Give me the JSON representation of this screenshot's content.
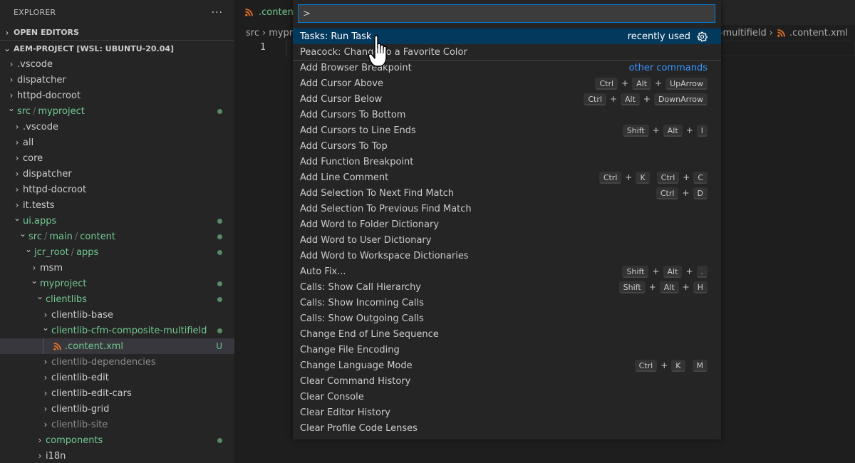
{
  "sidebar": {
    "title": "EXPLORER",
    "more_label": "···",
    "open_editors_label": "OPEN EDITORS",
    "root_label": "AEM-PROJECT [WSL: UBUNTU-20.04]",
    "tree": [
      {
        "label": ".vscode",
        "depth": 0,
        "expanded": false,
        "style": "normal"
      },
      {
        "label": "dispatcher",
        "depth": 0,
        "expanded": false,
        "style": "normal"
      },
      {
        "label": "httpd-docroot",
        "depth": 0,
        "expanded": false,
        "style": "normal"
      },
      {
        "label": "src / myproject",
        "parts": [
          "src",
          "myproject"
        ],
        "depth": 0,
        "expanded": true,
        "style": "green",
        "dot": true
      },
      {
        "label": ".vscode",
        "depth": 1,
        "expanded": false,
        "style": "normal"
      },
      {
        "label": "all",
        "depth": 1,
        "expanded": false,
        "style": "normal"
      },
      {
        "label": "core",
        "depth": 1,
        "expanded": false,
        "style": "normal"
      },
      {
        "label": "dispatcher",
        "depth": 1,
        "expanded": false,
        "style": "normal"
      },
      {
        "label": "httpd-docroot",
        "depth": 1,
        "expanded": false,
        "style": "normal"
      },
      {
        "label": "it.tests",
        "depth": 1,
        "expanded": false,
        "style": "normal"
      },
      {
        "label": "ui.apps",
        "depth": 1,
        "expanded": true,
        "style": "green",
        "dot": true
      },
      {
        "label": "src / main / content",
        "parts": [
          "src",
          "main",
          "content"
        ],
        "depth": 2,
        "expanded": true,
        "style": "green",
        "dot": true
      },
      {
        "label": "jcr_root / apps",
        "parts": [
          "jcr_root",
          "apps"
        ],
        "depth": 3,
        "expanded": true,
        "style": "green",
        "dot": true
      },
      {
        "label": "msm",
        "depth": 4,
        "expanded": false,
        "style": "normal"
      },
      {
        "label": "myproject",
        "depth": 4,
        "expanded": true,
        "style": "green",
        "dot": true
      },
      {
        "label": "clientlibs",
        "depth": 5,
        "expanded": true,
        "style": "green",
        "dot": true
      },
      {
        "label": "clientlib-base",
        "depth": 6,
        "expanded": false,
        "style": "normal"
      },
      {
        "label": "clientlib-cfm-composite-multifield",
        "depth": 6,
        "expanded": true,
        "style": "green",
        "dot": true
      },
      {
        "label": ".content.xml",
        "depth": 7,
        "file": true,
        "icon": "rss-icon",
        "style": "green",
        "badge": "U",
        "selected": true
      },
      {
        "label": "clientlib-dependencies",
        "depth": 6,
        "expanded": false,
        "style": "dim"
      },
      {
        "label": "clientlib-edit",
        "depth": 6,
        "expanded": false,
        "style": "normal"
      },
      {
        "label": "clientlib-edit-cars",
        "depth": 6,
        "expanded": false,
        "style": "normal"
      },
      {
        "label": "clientlib-grid",
        "depth": 6,
        "expanded": false,
        "style": "normal"
      },
      {
        "label": "clientlib-site",
        "depth": 6,
        "expanded": false,
        "style": "dim"
      },
      {
        "label": "components",
        "depth": 5,
        "expanded": false,
        "style": "green",
        "dot": true
      },
      {
        "label": "i18n",
        "depth": 5,
        "expanded": false,
        "style": "normal"
      }
    ]
  },
  "editor": {
    "tab_label": ".content.",
    "breadcrumb_left": [
      "src",
      "mypro"
    ],
    "breadcrumb_right": [
      "te-multifield",
      ".content.xml"
    ],
    "line_number": "1"
  },
  "palette": {
    "input_value": ">",
    "items": [
      {
        "label": "Tasks: Run Task",
        "active": true,
        "meta": "recently used",
        "gear": true
      },
      {
        "label": "Peacock: Change to a Favorite Color"
      },
      {
        "label": "Add Browser Breakpoint",
        "other": "other commands",
        "sep_top": true
      },
      {
        "label": "Add Cursor Above",
        "keys": [
          [
            "Ctrl",
            "Alt",
            "UpArrow"
          ]
        ]
      },
      {
        "label": "Add Cursor Below",
        "keys": [
          [
            "Ctrl",
            "Alt",
            "DownArrow"
          ]
        ]
      },
      {
        "label": "Add Cursors To Bottom"
      },
      {
        "label": "Add Cursors to Line Ends",
        "keys": [
          [
            "Shift",
            "Alt",
            "I"
          ]
        ]
      },
      {
        "label": "Add Cursors To Top"
      },
      {
        "label": "Add Function Breakpoint"
      },
      {
        "label": "Add Line Comment",
        "keys": [
          [
            "Ctrl",
            "K"
          ],
          [
            "Ctrl",
            "C"
          ]
        ]
      },
      {
        "label": "Add Selection To Next Find Match",
        "keys": [
          [
            "Ctrl",
            "D"
          ]
        ]
      },
      {
        "label": "Add Selection To Previous Find Match"
      },
      {
        "label": "Add Word to Folder Dictionary"
      },
      {
        "label": "Add Word to User Dictionary"
      },
      {
        "label": "Add Word to Workspace Dictionaries"
      },
      {
        "label": "Auto Fix...",
        "keys": [
          [
            "Shift",
            "Alt",
            "."
          ]
        ]
      },
      {
        "label": "Calls: Show Call Hierarchy",
        "keys": [
          [
            "Shift",
            "Alt",
            "H"
          ]
        ]
      },
      {
        "label": "Calls: Show Incoming Calls"
      },
      {
        "label": "Calls: Show Outgoing Calls"
      },
      {
        "label": "Change End of Line Sequence"
      },
      {
        "label": "Change File Encoding"
      },
      {
        "label": "Change Language Mode",
        "keys": [
          [
            "Ctrl",
            "K"
          ],
          [
            "M"
          ]
        ]
      },
      {
        "label": "Clear Command History"
      },
      {
        "label": "Clear Console"
      },
      {
        "label": "Clear Editor History"
      },
      {
        "label": "Clear Profile Code Lenses"
      }
    ]
  },
  "colors": {
    "accent_focus": "#007fd4",
    "active_item": "#04395e",
    "git_added": "#73c991",
    "link": "#3794ff",
    "rss_orange": "#e8702a"
  }
}
